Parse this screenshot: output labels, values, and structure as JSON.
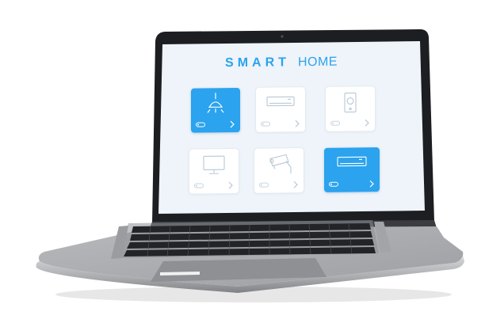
{
  "screen": {
    "title_part1": "SMART",
    "title_part2": "HOME",
    "accent_color": "#2ba3ee",
    "background_color": "#eef4fa"
  },
  "devices": [
    {
      "icon": "ceiling-lamp-icon",
      "active": true
    },
    {
      "icon": "air-conditioner-icon",
      "active": false
    },
    {
      "icon": "speaker-icon",
      "active": false
    },
    {
      "icon": "tv-monitor-icon",
      "active": false
    },
    {
      "icon": "security-camera-icon",
      "active": false
    },
    {
      "icon": "air-conditioner-icon",
      "active": true
    }
  ]
}
